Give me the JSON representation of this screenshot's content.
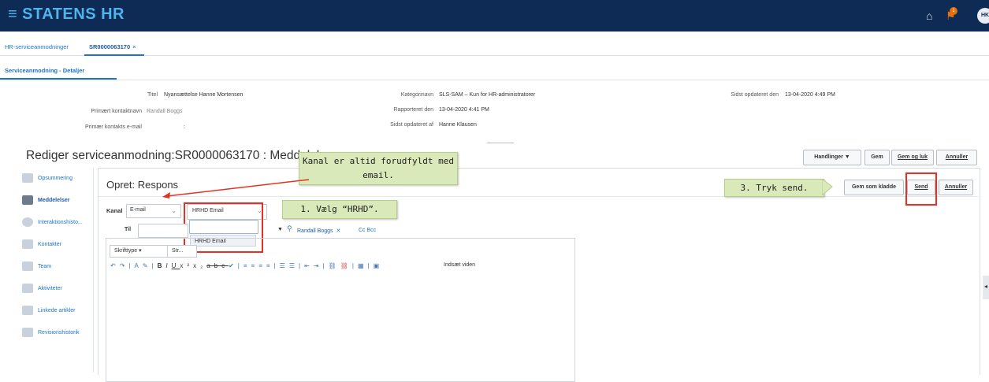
{
  "header": {
    "brand": "STATENS HR",
    "avatar_initials": "HK",
    "notification_count": "1"
  },
  "tabs": {
    "list_tab": "HR-serviceanmodninger",
    "record_tab": "SR0000063170",
    "close_symbol": "×"
  },
  "subtabs": {
    "details": "Serviceanmodning - Detaljer"
  },
  "details": {
    "titel_label": "Titel",
    "titel_value": "Nyansættelse Hanne Mortensen",
    "primary_contact_label": "Primært kontaktnavn",
    "primary_contact_value": "Randall Boggs",
    "primary_email_label": "Primær kontakts e-mail",
    "primary_email_value": ":",
    "category_label": "Kategorinavn",
    "category_value": "SLS-SAM – Kun for HR-administratorer",
    "reported_label": "Rapporteret den",
    "reported_value": "13-04-2020 4:41 PM",
    "updated_by_label": "Sidst opdateret af",
    "updated_by_value": "Hanne Klausen",
    "updated_on_label": "Sidst opdateret den",
    "updated_on_value": "13-04-2020 4:49 PM"
  },
  "page": {
    "title": "Rediger serviceanmodning:SR0000063170 : Meddelelser",
    "handlinger": "Handlinger ▼",
    "gem": "Gem",
    "gem_og_luk": "Gem og luk",
    "annuller": "Annuller"
  },
  "sidebar": {
    "items": [
      {
        "label": "Opsummering",
        "icon": "summary-icon"
      },
      {
        "label": "Meddelelser",
        "icon": "messages-icon"
      },
      {
        "label": "Interaktionshisto...",
        "icon": "clock-icon"
      },
      {
        "label": "Kontakter",
        "icon": "contacts-icon"
      },
      {
        "label": "Team",
        "icon": "team-icon"
      },
      {
        "label": "Aktiviteter",
        "icon": "activities-icon"
      },
      {
        "label": "Linkede artikler",
        "icon": "link-icon"
      },
      {
        "label": "Revisionshistorik",
        "icon": "history-icon"
      }
    ]
  },
  "response": {
    "title": "Opret: Respons",
    "gem_som_kladde": "Gem som kladde",
    "send": "Send",
    "annuller": "Annuller",
    "kanal_label": "Kanal",
    "kanal_value": "E-mail",
    "from_value": "HRHD Email",
    "dropdown_option": "HRHD Email",
    "til_label": "Til",
    "recipient": "Randall Boggs",
    "recipient_remove": "✕",
    "cc_bcc": "Cc Bcc"
  },
  "editor": {
    "font_type": "Skrifttype",
    "font_size": "Str...",
    "insert_video": "Indsæt viden"
  },
  "callouts": {
    "kanal": "Kanal er altid forudfyldt med email.",
    "step1": "1. Vælg “HRHD”.",
    "step3": "3. Tryk send."
  },
  "colors": {
    "header_bg": "#0d2b55",
    "brand": "#4fb4ea",
    "link": "#1f74c5",
    "highlight_red": "#e63024",
    "callout_green": "#d9e9b9"
  }
}
